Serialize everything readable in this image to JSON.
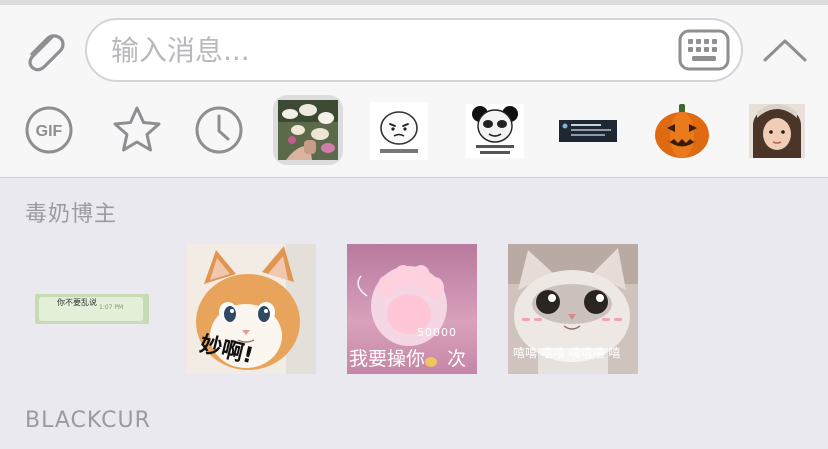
{
  "composer": {
    "input_placeholder": "输入消息...",
    "input_value": ""
  },
  "tray": {
    "items": [
      {
        "name": "gif-tab",
        "label": "GIF"
      },
      {
        "name": "favorites-tab",
        "icon": "star-icon"
      },
      {
        "name": "recent-tab",
        "icon": "clock-icon"
      },
      {
        "name": "sticker-set-flowers",
        "selected": true
      },
      {
        "name": "sticker-set-face"
      },
      {
        "name": "sticker-set-panda"
      },
      {
        "name": "sticker-set-screenshot"
      },
      {
        "name": "sticker-set-pumpkin"
      },
      {
        "name": "sticker-set-portrait"
      }
    ]
  },
  "sections": [
    {
      "title": "毒奶博主",
      "stickers": [
        {
          "name": "chat-bubble-sticker",
          "text": "你不要乱说",
          "time": "1:07 PM"
        },
        {
          "name": "cat-miao-sticker",
          "caption": "妙啊!"
        },
        {
          "name": "cat-paw-sticker",
          "caption": "我要操你",
          "caption2": "50000",
          "caption3": "次"
        },
        {
          "name": "cat-giggle-sticker",
          "caption": "嘻嘻 嘻嘻  嘻嘻嘻 嘻"
        }
      ]
    },
    {
      "title": "BLACKCUR"
    }
  ],
  "colors": {
    "icon_gray": "#8e8e93",
    "panel_bg": "#e9e9ef",
    "composer_bg": "#f7f7f7"
  }
}
